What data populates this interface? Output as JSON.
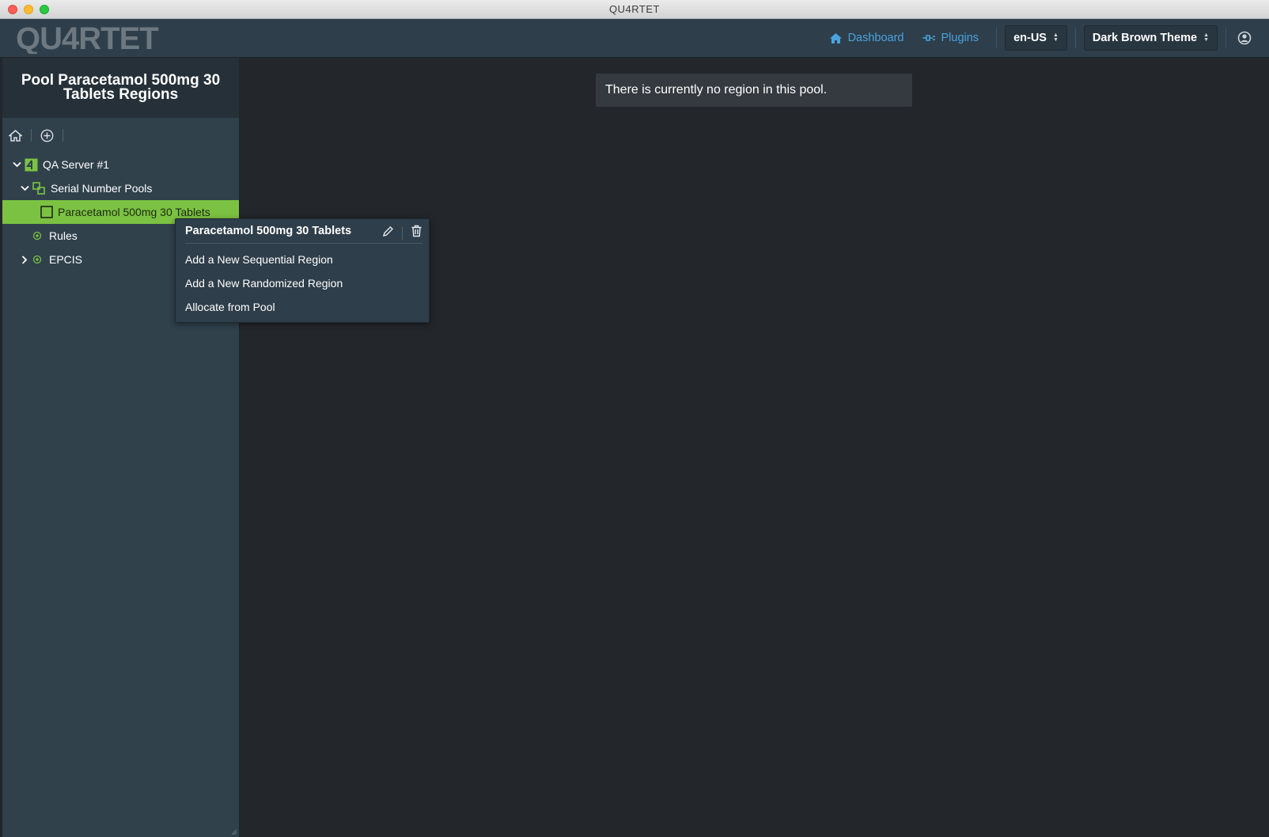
{
  "window": {
    "title": "QU4RTET"
  },
  "navbar": {
    "logo_text": "QU4RTET",
    "dashboard_label": "Dashboard",
    "plugins_label": "Plugins",
    "locale_value": "en-US",
    "theme_value": "Dark Brown Theme"
  },
  "sidebar": {
    "header_title": "Pool Paracetamol 500mg 30 Tablets Regions",
    "tree": {
      "server": "QA Server #1",
      "pools": "Serial Number Pools",
      "pool_item": "Paracetamol 500mg 30 Tablets",
      "rules": "Rules",
      "epcis": "EPCIS"
    }
  },
  "main": {
    "message": "There is currently no region in this pool."
  },
  "context_menu": {
    "title": "Paracetamol 500mg 30 Tablets",
    "items": [
      "Add a New Sequential Region",
      "Add a New Randomized Region",
      "Allocate from Pool"
    ]
  },
  "colors": {
    "accent_green": "#7cc242",
    "link_blue": "#4aa3e0",
    "navbar": "#2e3e4a",
    "sidebar": "#30414c",
    "main_bg": "#23262b"
  }
}
